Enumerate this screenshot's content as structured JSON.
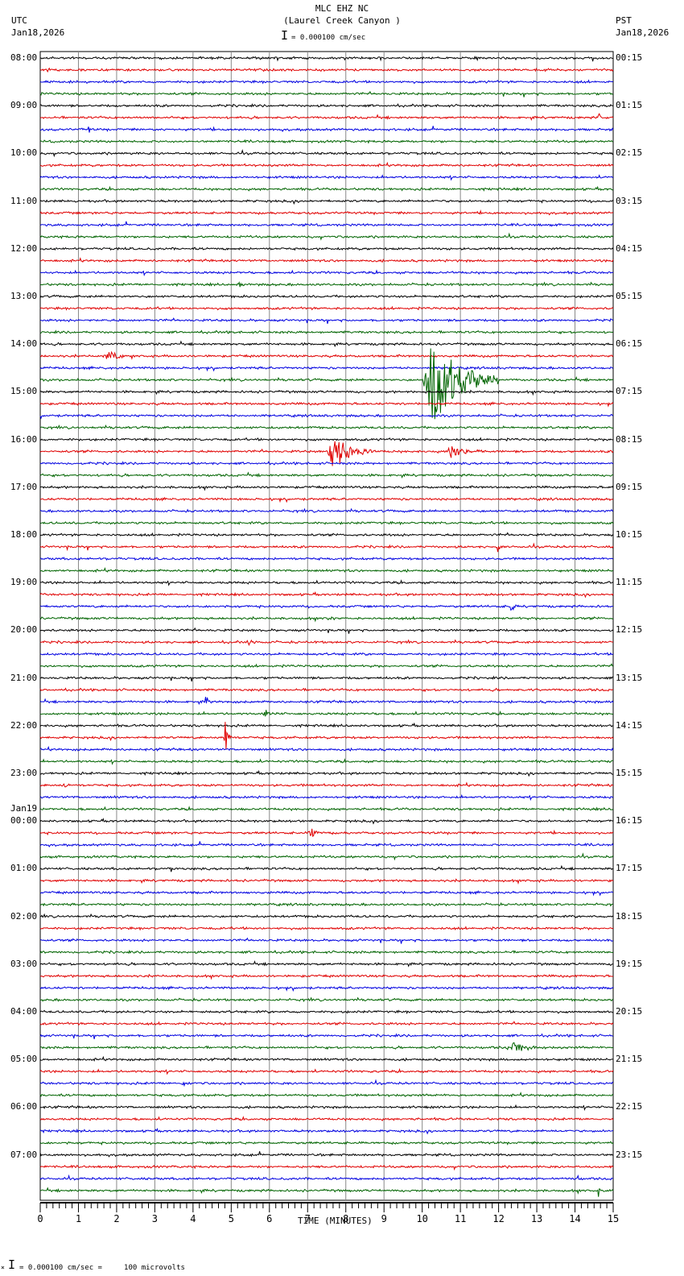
{
  "header": {
    "station": "MLC EHZ NC",
    "location": "(Laurel Creek Canyon )",
    "scale": "= 0.000100 cm/sec",
    "left_tz": "UTC",
    "left_date": "Jan18,2026",
    "right_tz": "PST",
    "right_date": "Jan18,2026"
  },
  "footer": {
    "scale_note": "= 0.000100 cm/sec =     100 microvolts",
    "corner_mark": "×"
  },
  "chart_data": {
    "type": "line",
    "title": "MLC EHZ NC (Laurel Creek Canyon )",
    "xlabel": "TIME (MINUTES)",
    "xlim": [
      0,
      15
    ],
    "x_ticks": [
      "0",
      "1",
      "2",
      "3",
      "4",
      "5",
      "6",
      "7",
      "8",
      "9",
      "10",
      "11",
      "12",
      "13",
      "14",
      "15"
    ],
    "trace_count": 96,
    "trace_minutes": 15,
    "trace_colors": [
      "#000000",
      "#e00000",
      "#0000e0",
      "#006400"
    ],
    "grid": true,
    "left_labels": [
      "08:00",
      "09:00",
      "10:00",
      "11:00",
      "12:00",
      "13:00",
      "14:00",
      "15:00",
      "16:00",
      "17:00",
      "18:00",
      "19:00",
      "20:00",
      "21:00",
      "22:00",
      "23:00",
      "00:00",
      "01:00",
      "02:00",
      "03:00",
      "04:00",
      "05:00",
      "06:00",
      "07:00"
    ],
    "date_change_label": "Jan19",
    "right_labels": [
      "00:15",
      "01:15",
      "02:15",
      "03:15",
      "04:15",
      "05:15",
      "06:15",
      "07:15",
      "08:15",
      "09:15",
      "10:15",
      "11:15",
      "12:15",
      "13:15",
      "14:15",
      "15:15",
      "16:15",
      "17:15",
      "18:15",
      "19:15",
      "20:15",
      "21:15",
      "22:15",
      "23:15"
    ],
    "events": [
      {
        "trace": 5,
        "minute": 14.6,
        "amplitude": 12,
        "duration": 0.1
      },
      {
        "trace": 6,
        "minute": 1.25,
        "amplitude": 9,
        "duration": 0.08
      },
      {
        "trace": 19,
        "minute": 5.2,
        "amplitude": 6,
        "duration": 0.1
      },
      {
        "trace": 25,
        "minute": 1.7,
        "amplitude": 10,
        "duration": 0.6
      },
      {
        "trace": 27,
        "minute": 10.0,
        "amplitude": 55,
        "duration": 2.0
      },
      {
        "trace": 33,
        "minute": 7.5,
        "amplitude": 22,
        "duration": 1.2
      },
      {
        "trace": 33,
        "minute": 10.6,
        "amplitude": 9,
        "duration": 1.0
      },
      {
        "trace": 41,
        "minute": 11.95,
        "amplitude": 8,
        "duration": 0.15
      },
      {
        "trace": 46,
        "minute": 12.3,
        "amplitude": 6,
        "duration": 0.15
      },
      {
        "trace": 47,
        "minute": 7.5,
        "amplitude": 4,
        "duration": 0.3
      },
      {
        "trace": 49,
        "minute": 5.4,
        "amplitude": 4,
        "duration": 0.4
      },
      {
        "trace": 54,
        "minute": 4.3,
        "amplitude": 14,
        "duration": 0.15
      },
      {
        "trace": 55,
        "minute": 5.8,
        "amplitude": 4,
        "duration": 0.5
      },
      {
        "trace": 57,
        "minute": 4.8,
        "amplitude": 28,
        "duration": 0.2
      },
      {
        "trace": 61,
        "minute": 0.6,
        "amplitude": 5,
        "duration": 0.2
      },
      {
        "trace": 65,
        "minute": 7.0,
        "amplitude": 5,
        "duration": 0.6
      },
      {
        "trace": 68,
        "minute": 3.4,
        "amplitude": 7,
        "duration": 0.1
      },
      {
        "trace": 83,
        "minute": 12.2,
        "amplitude": 8,
        "duration": 1.0
      },
      {
        "trace": 86,
        "minute": 3.7,
        "amplitude": 4,
        "duration": 0.3
      },
      {
        "trace": 94,
        "minute": 14.05,
        "amplitude": 6,
        "duration": 0.1
      },
      {
        "trace": 95,
        "minute": 14.6,
        "amplitude": 8,
        "duration": 0.1
      }
    ]
  }
}
